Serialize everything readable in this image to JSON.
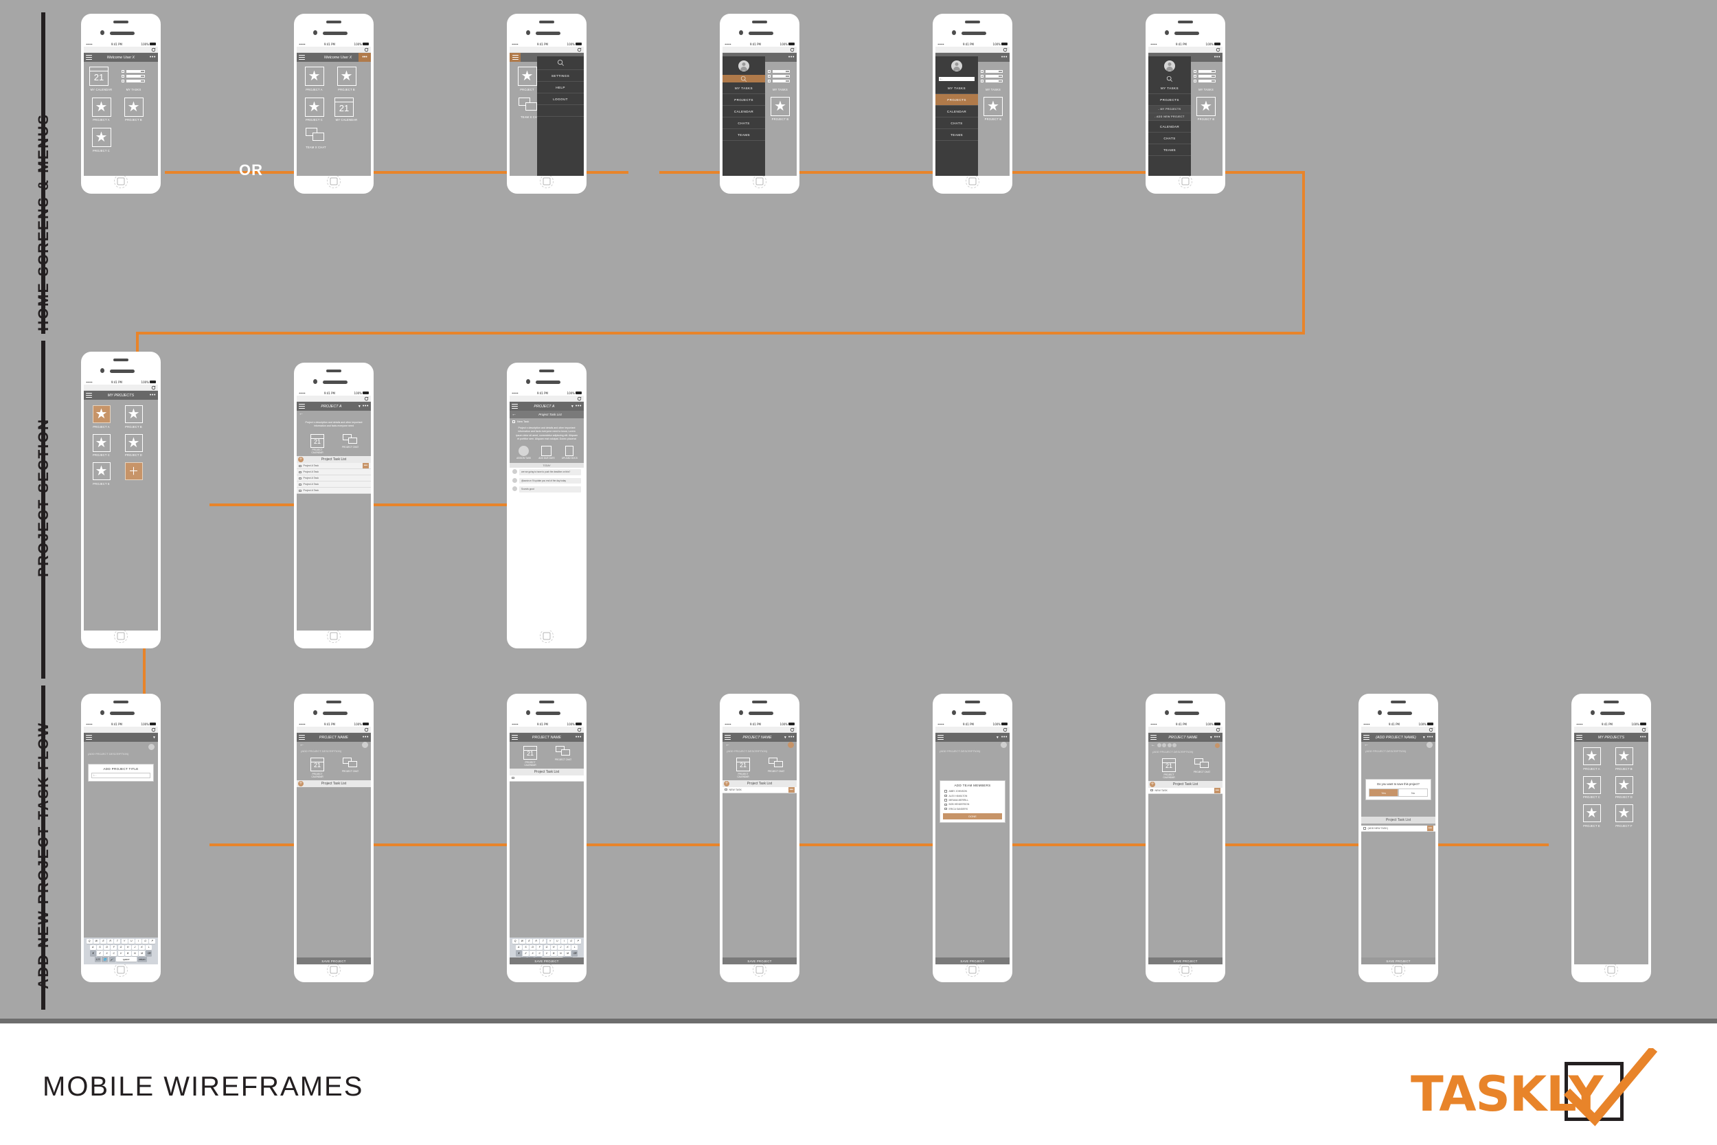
{
  "page": {
    "title": "MOBILE WIREFRAMES",
    "brand": "TASKLY",
    "accent": "#e8842a",
    "bg": "#a6a6a6",
    "dark": "#3d3d3d",
    "amber": "#b07a4a"
  },
  "sections": [
    {
      "id": "home",
      "label": "HOME SCREENS & MENUS"
    },
    {
      "id": "project",
      "label": "PROJECT SECTION"
    },
    {
      "id": "addnew",
      "label": "ADD NEW PROJECT TASK FLOW"
    }
  ],
  "or_label": "OR",
  "status": {
    "dots": "•••••",
    "wifi": "▼",
    "time": "9:41 PM",
    "battery": "100%",
    "bt": "✱"
  },
  "row1": {
    "p1": {
      "appbar_title": "Welcome User X",
      "tiles": [
        {
          "icon": "calendar-icon",
          "num": "21",
          "cap": "MY CALENDAR"
        },
        {
          "icon": "tasks-icon",
          "cap": "MY TASKS"
        },
        {
          "icon": "star-icon",
          "cap": "PROJECT A"
        },
        {
          "icon": "star-icon",
          "cap": "PROJECT B"
        },
        {
          "icon": "star-icon",
          "cap": "PROJECT C"
        }
      ]
    },
    "p2": {
      "appbar_title": "Welcome User X",
      "tiles": [
        {
          "icon": "star-icon",
          "cap": "PROJECT A"
        },
        {
          "icon": "star-icon",
          "cap": "PROJECT B"
        },
        {
          "icon": "star-icon",
          "cap": "PROJECT C"
        },
        {
          "icon": "calendar-icon",
          "num": "21",
          "cap": "MY CALENDAR"
        },
        {
          "icon": "chat-icon",
          "cap": "TEAM X CHAT"
        }
      ]
    },
    "p3": {
      "drawer": {
        "search": "search-icon",
        "items": [
          "SETTINGS",
          "HELP",
          "LOGOUT"
        ]
      },
      "behind": [
        {
          "cap": "PROJECT"
        },
        {
          "cap": "PROJECT"
        },
        {
          "cap": "TEAM X CH"
        }
      ]
    },
    "p4": {
      "drawer": {
        "avatar": "avatar-icon",
        "search": "search-icon",
        "items": [
          "MY TASKS",
          "PROJECTS",
          "CALENDAR",
          "CHATS",
          "TEAMS"
        ]
      },
      "behind_caption": "MY TASKS"
    },
    "p5": {
      "drawer": {
        "avatar": "avatar-icon",
        "search_value": "L...",
        "items": [
          "MY TASKS",
          "PROJECTS",
          "CALENDAR",
          "CHATS",
          "TEAMS"
        ],
        "selected": "PROJECTS"
      },
      "behind_caption": "MY TASKS",
      "behind_caption2": "PROJECT B"
    },
    "p6": {
      "drawer": {
        "avatar": "avatar-icon",
        "search": "search-icon",
        "items": [
          "MY TASKS",
          "PROJECTS",
          "CALENDAR",
          "CHATS",
          "TEAMS"
        ],
        "sub_items": [
          "- MY PROJECTS",
          "- ADD NEW PROJECT"
        ],
        "selected_sub": "- MY PROJECTS"
      },
      "behind_caption": "MY TASKS",
      "behind_caption2": "PROJECT B"
    }
  },
  "row2": {
    "p1": {
      "appbar_title": "MY PROJECTS",
      "tiles": [
        {
          "cap": "PROJECT A",
          "selected": true
        },
        {
          "cap": "PROJECT B"
        },
        {
          "cap": "PROJECT C"
        },
        {
          "cap": "PROJECT D"
        },
        {
          "cap": "PROJECT E"
        },
        {
          "cap": "add-project",
          "is_add": true
        }
      ]
    },
    "p2": {
      "appbar_title": "PROJECT A",
      "description": "Project x description and details and other important information and facts everyone need",
      "shortcuts": [
        {
          "icon": "calendar-icon",
          "num": "21",
          "cap": "PROJECT CALENDAR"
        },
        {
          "icon": "chat-icon",
          "cap": "PROJECT CHAT"
        }
      ],
      "list_title": "Project Task List",
      "tasks": [
        "Project A Task",
        "Project A Task",
        "Project A Task",
        "Project A Task",
        "Project A Task"
      ]
    },
    "p3": {
      "appbar_title": "PROJECT A",
      "screen_title": "Project Task List",
      "task_name": "New Task",
      "description": "Project x description and details and other important information and facts everyone need to know, Lorem ipsum dolor sit amet, consectetur adipiscing elit. Aliquam et porttitor sem. Aliquam erat volutpat. Donec placerat",
      "actions": [
        {
          "icon": "assign-icon",
          "cap": "ASSIGN TASK"
        },
        {
          "icon": "calendar-icon",
          "cap": "ADD DUE DATE"
        },
        {
          "icon": "doc-icon",
          "cap": "UPLOAD DOCS"
        }
      ],
      "day_divider": "TODAY",
      "messages": [
        "are we going to have to push the deadline on this?",
        "@aarón.m i'll update you end of the day today",
        "Sounds good"
      ]
    }
  },
  "row3": {
    "p1": {
      "modal_title": "ADD PROJECT TITLE",
      "modal_input": "L...",
      "placeholder": "(ADD PROJECT DESCRIPTION)",
      "keyboard": {
        "row1": [
          "Q",
          "W",
          "E",
          "R",
          "T",
          "Y",
          "U",
          "I",
          "O",
          "P"
        ],
        "row2": [
          "A",
          "S",
          "D",
          "F",
          "G",
          "H",
          "J",
          "K",
          "L"
        ],
        "row3": [
          "⬆",
          "Z",
          "X",
          "C",
          "V",
          "B",
          "N",
          "M",
          "⌫"
        ],
        "row4": [
          "123",
          "🌐",
          "🎤",
          "space",
          "return"
        ]
      }
    },
    "p2": {
      "appbar_title": "PROJECT NAME",
      "placeholder": "(ADD PROJECT DESCRIPTION)",
      "shortcuts": [
        {
          "icon": "calendar-icon",
          "num": "21",
          "cap": "PROJECT CALENDAR"
        },
        {
          "icon": "chat-icon",
          "cap": "PROJECT CHAT"
        }
      ],
      "list_title": "Project Task List",
      "save_label": "SAVE PROJECT"
    },
    "p3": {
      "appbar_title": "PROJECT NAME",
      "placeholder": "(ADD PROJECT DESCRIPTION)",
      "shortcuts": [
        {
          "icon": "calendar-icon",
          "num": "21",
          "cap": "PROJECT CALENDAR"
        },
        {
          "icon": "chat-icon",
          "cap": "PROJECT CHAT"
        }
      ],
      "list_title": "Project Task List",
      "keyboard": {
        "row1": [
          "Q",
          "W",
          "E",
          "R",
          "T",
          "Y",
          "U",
          "I",
          "O",
          "P"
        ],
        "row2": [
          "A",
          "S",
          "D",
          "F",
          "G",
          "H",
          "J",
          "K",
          "L"
        ],
        "row3": [
          "⬆",
          "Z",
          "X",
          "C",
          "V",
          "B",
          "N",
          "M",
          "⌫"
        ],
        "row4": [
          "123",
          "🌐",
          "🎤",
          "space",
          "return"
        ]
      },
      "save_label": "SAVE PROJECT"
    },
    "p4": {
      "appbar_title": "PROJECT NAME",
      "placeholder": "(ADD PROJECT DESCRIPTION)",
      "shortcuts": [
        {
          "icon": "calendar-icon",
          "num": "21",
          "cap": "PROJECT CALENDAR"
        },
        {
          "icon": "chat-icon",
          "cap": "PROJECT CHAT"
        }
      ],
      "list_title": "Project Task List",
      "new_task": "NEW TASK",
      "save_label": "SAVE PROJECT"
    },
    "p5": {
      "placeholder": "(ADD PROJECT DESCRIPTION)",
      "modal_title": "ADD TEAM MEMBERS",
      "members": [
        "ABBY JOHNSON",
        "ALEX HAMILTON",
        "MIRANA MERRILL",
        "BOB HENDERSON",
        "ERICA SANDERS"
      ],
      "done_label": "DONE",
      "save_label": "SAVE PROJECT"
    },
    "p6": {
      "appbar_title": "PROJECT NAME",
      "placeholder": "(ADD PROJECT DESCRIPTION)",
      "shortcuts": [
        {
          "icon": "calendar-icon",
          "num": "21",
          "cap": "PROJECT CALENDAR"
        },
        {
          "icon": "chat-icon",
          "cap": "PROJECT CHAT"
        }
      ],
      "list_title": "Project Task List",
      "new_task": "NEW TASK",
      "save_label": "SAVE PROJECT"
    },
    "p7": {
      "appbar_title": "(ADD PROJECT NAME)",
      "placeholder": "(ADD PROJECT DESCRIPTION)",
      "confirm_text": "Do you want to save this project?",
      "yes_label": "Yes",
      "no_label": "No",
      "list_title": "Project Task List",
      "new_task": "(ADD NEW TASK)",
      "save_label": "SAVE PROJECT"
    },
    "p8": {
      "appbar_title": "MY PROJECTS",
      "tiles": [
        {
          "cap": "PROJECT A"
        },
        {
          "cap": "PROJECT B"
        },
        {
          "cap": "PROJECT C"
        },
        {
          "cap": "PROJECT D"
        },
        {
          "cap": "PROJECT E"
        },
        {
          "cap": "PROJECT F"
        }
      ]
    }
  }
}
